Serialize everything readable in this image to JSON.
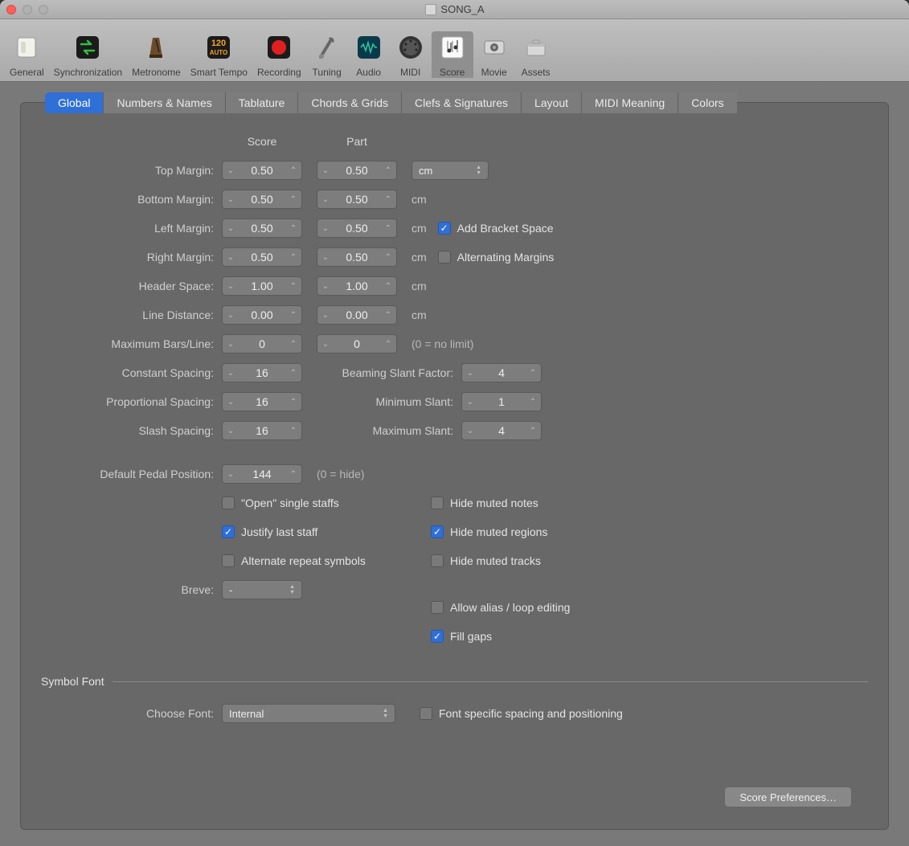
{
  "window": {
    "title": "SONG_A"
  },
  "toolbar": {
    "items": [
      {
        "label": "General"
      },
      {
        "label": "Synchronization"
      },
      {
        "label": "Metronome"
      },
      {
        "label": "Smart Tempo",
        "badge": "120",
        "badge2": "AUTO"
      },
      {
        "label": "Recording"
      },
      {
        "label": "Tuning"
      },
      {
        "label": "Audio"
      },
      {
        "label": "MIDI"
      },
      {
        "label": "Score"
      },
      {
        "label": "Movie"
      },
      {
        "label": "Assets"
      }
    ],
    "active": 8
  },
  "tabs": [
    "Global",
    "Numbers & Names",
    "Tablature",
    "Chords & Grids",
    "Clefs & Signatures",
    "Layout",
    "MIDI Meaning",
    "Colors"
  ],
  "tabs_active": 0,
  "columns": {
    "score": "Score",
    "part": "Part"
  },
  "margins": {
    "top": {
      "label": "Top Margin:",
      "score": "0.50",
      "part": "0.50"
    },
    "bottom": {
      "label": "Bottom Margin:",
      "score": "0.50",
      "part": "0.50"
    },
    "left": {
      "label": "Left Margin:",
      "score": "0.50",
      "part": "0.50"
    },
    "right": {
      "label": "Right Margin:",
      "score": "0.50",
      "part": "0.50"
    },
    "header": {
      "label": "Header Space:",
      "score": "1.00",
      "part": "1.00"
    },
    "linedist": {
      "label": "Line Distance:",
      "score": "0.00",
      "part": "0.00"
    },
    "maxbars": {
      "label": "Maximum Bars/Line:",
      "score": "0",
      "part": "0",
      "note": "(0 = no limit)"
    }
  },
  "unit": {
    "value": "cm",
    "label": "cm"
  },
  "opts": {
    "add_bracket": {
      "label": "Add Bracket Space",
      "checked": true
    },
    "alt_margins": {
      "label": "Alternating Margins",
      "checked": false
    }
  },
  "spacing": {
    "constant": {
      "label": "Constant Spacing:",
      "value": "16"
    },
    "proportional": {
      "label": "Proportional Spacing:",
      "value": "16"
    },
    "slash": {
      "label": "Slash Spacing:",
      "value": "16"
    },
    "beaming": {
      "label": "Beaming Slant Factor:",
      "value": "4"
    },
    "minslant": {
      "label": "Minimum Slant:",
      "value": "1"
    },
    "maxslant": {
      "label": "Maximum Slant:",
      "value": "4"
    }
  },
  "pedal": {
    "label": "Default Pedal Position:",
    "value": "144",
    "note": "(0 = hide)"
  },
  "checks_left": {
    "open_single": {
      "label": "\"Open\" single staffs",
      "checked": false
    },
    "justify": {
      "label": "Justify last staff",
      "checked": true
    },
    "alt_repeat": {
      "label": "Alternate repeat symbols",
      "checked": false
    }
  },
  "checks_right": {
    "hide_notes": {
      "label": "Hide muted notes",
      "checked": false
    },
    "hide_regions": {
      "label": "Hide muted regions",
      "checked": true
    },
    "hide_tracks": {
      "label": "Hide muted tracks",
      "checked": false
    },
    "allow_alias": {
      "label": "Allow alias / loop editing",
      "checked": false
    },
    "fill_gaps": {
      "label": "Fill gaps",
      "checked": true
    }
  },
  "breve": {
    "label": "Breve:",
    "value": "-"
  },
  "symbol_font": {
    "section": "Symbol Font",
    "choose_label": "Choose Font:",
    "choose_value": "Internal",
    "fontspec": {
      "label": "Font specific spacing and positioning",
      "checked": false
    }
  },
  "footer_btn": "Score Preferences…"
}
